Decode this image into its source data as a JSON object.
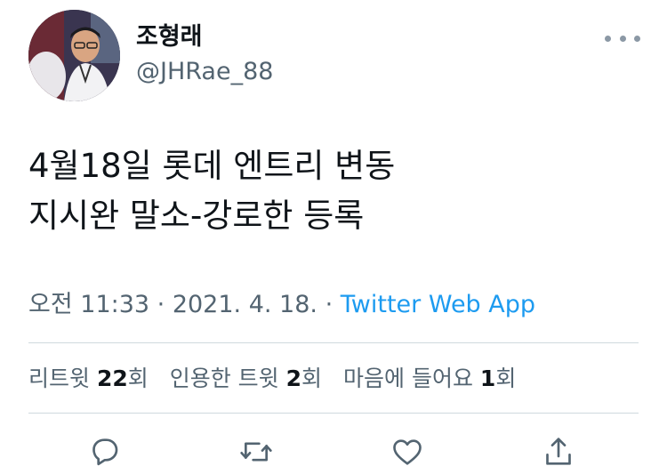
{
  "user": {
    "display_name": "조형래",
    "handle": "@JHRae_88"
  },
  "tweet": {
    "line1": "4월18일 롯데 엔트리 변동",
    "line2": "지시완 말소-강로한 등록"
  },
  "meta": {
    "time": "오전 11:33",
    "separator1": " · ",
    "date": "2021. 4. 18.",
    "separator2": " · ",
    "source": "Twitter Web App"
  },
  "stats": {
    "retweets_label": "리트윗 ",
    "retweets_count": "22",
    "retweets_unit": "회",
    "quotes_label": "인용한 트윗 ",
    "quotes_count": "2",
    "quotes_unit": "회",
    "likes_label": "마음에 들어요 ",
    "likes_count": "1",
    "likes_unit": "회"
  },
  "icons": {
    "more": "more-horizontal-icon",
    "reply": "reply-icon",
    "retweet": "retweet-icon",
    "like": "heart-icon",
    "share": "share-icon"
  },
  "colors": {
    "text": "#0f1419",
    "secondary": "#536471",
    "link": "#1d9bf0",
    "divider": "#cfd9de",
    "icon": "#536471"
  }
}
